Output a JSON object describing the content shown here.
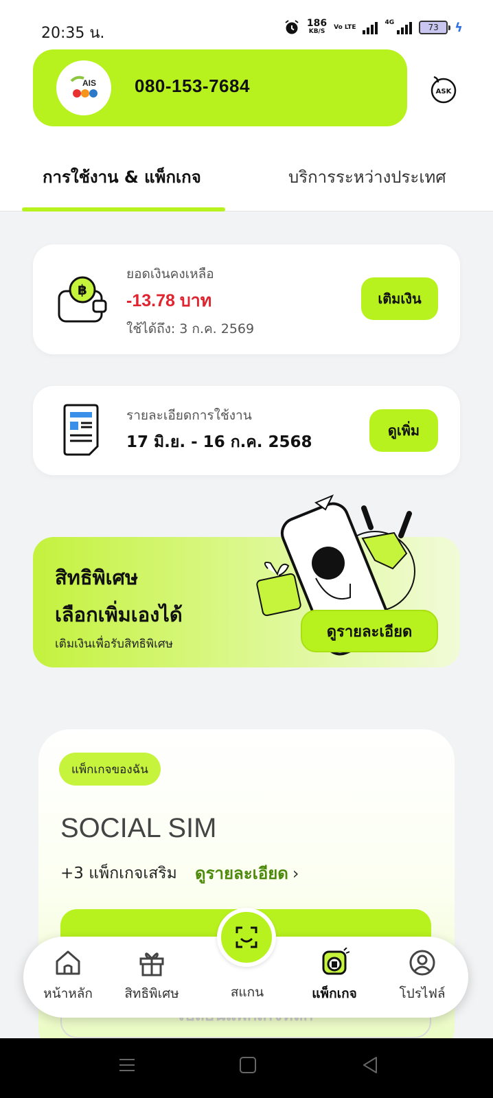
{
  "status_bar": {
    "time": "20:35 น.",
    "net_speed": "186",
    "net_unit": "KB/S",
    "volte": "Vo LTE",
    "network": "4G",
    "battery": "73"
  },
  "header": {
    "logo_text": "AIS",
    "phone_number": "080-153-7684"
  },
  "tabs": [
    {
      "label": "การใช้งาน & แพ็กเกจ",
      "active": true
    },
    {
      "label": "บริการระหว่างประเทศ",
      "active": false
    }
  ],
  "balance_card": {
    "label": "ยอดเงินคงเหลือ",
    "value": "-13.78 บาท",
    "expiry": "ใช้ได้ถึง: 3 ก.ค. 2569",
    "button": "เติมเงิน"
  },
  "usage_card": {
    "label": "รายละเอียดการใช้งาน",
    "period": "17 มิ.ย. - 16 ก.ค. 2568",
    "button": "ดูเพิ่ม"
  },
  "promo": {
    "title_line1": "สิทธิพิเศษ",
    "title_line2": "เลือกเพิ่มเองได้",
    "subtitle": "เติมเงินเพื่อรับสิทธิพิเศษ",
    "button": "ดูรายละเอียด"
  },
  "package": {
    "tag": "แพ็กเกจของฉัน",
    "name": "SOCIAL SIM",
    "addons": "+3 แพ็กเกจเสริม",
    "details_link": "ดูรายละเอียด",
    "change_button": "เปลี่ยนแพ็กเกจหลัก"
  },
  "bottom_nav": [
    {
      "label": "หน้าหลัก",
      "icon": "home-icon"
    },
    {
      "label": "สิทธิพิเศษ",
      "icon": "gift-icon"
    },
    {
      "label": "สแกน",
      "icon": "scan-icon"
    },
    {
      "label": "แพ็กเกจ",
      "icon": "sim-package-icon",
      "active": true
    },
    {
      "label": "โปรไฟล์",
      "icon": "profile-icon"
    }
  ],
  "colors": {
    "accent": "#b8f21e",
    "negative": "#e0242f",
    "link": "#4d8a0c"
  }
}
